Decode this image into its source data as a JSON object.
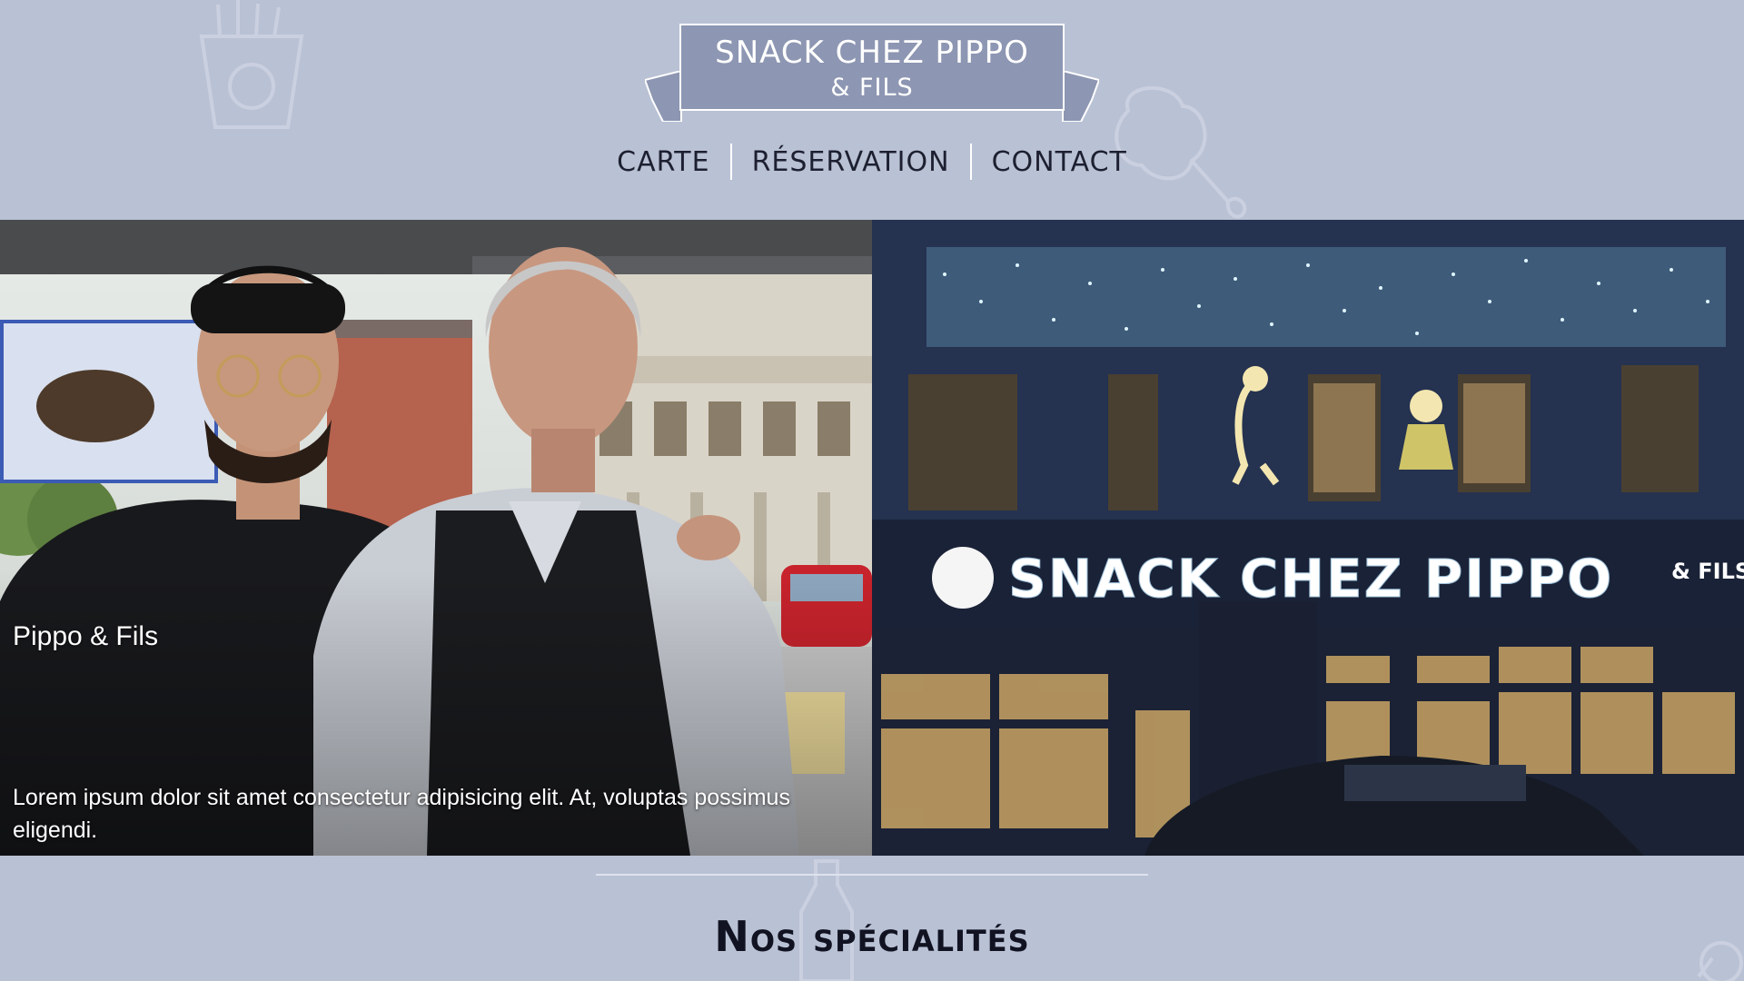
{
  "header": {
    "logo_title": "SNACK CHEZ PIPPO",
    "logo_subtitle": "& FILS"
  },
  "nav": {
    "items": [
      {
        "label": "CARTE"
      },
      {
        "label": "RÉSERVATION"
      },
      {
        "label": "CONTACT"
      }
    ]
  },
  "hero": {
    "left_panel": {
      "title": "Pippo & Fils",
      "text": "Lorem ipsum dolor sit amet consectetur adipisicing elit. At, voluptas possimus eligendi."
    },
    "right_panel": {
      "storefront_sign": "SNACK CHEZ PIPPO",
      "storefront_sign_suffix": "& FILS"
    }
  },
  "specialties": {
    "title": "Nos spécialités"
  },
  "colors": {
    "background": "#b9c1d4",
    "logo_box": "#8d96b2",
    "nav_text": "#1d2030"
  }
}
